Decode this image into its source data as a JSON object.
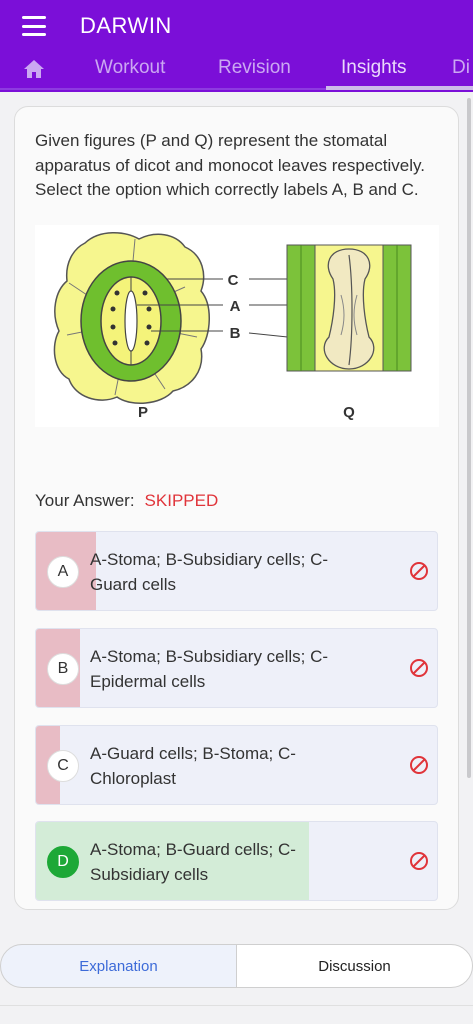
{
  "app": {
    "title": "DARWIN"
  },
  "tabs": [
    {
      "label": "Workout"
    },
    {
      "label": "Revision"
    },
    {
      "label": "Insights"
    },
    {
      "label": "Di"
    }
  ],
  "question": {
    "text": "Given figures (P and Q) represent the stomatal apparatus of dicot and monocot leaves respectively. Select the option which correctly labels A, B and C.",
    "figure_labels": {
      "c": "C",
      "a": "A",
      "b": "B",
      "p": "P",
      "q": "Q"
    }
  },
  "answer": {
    "label": "Your Answer:",
    "status": "SKIPPED"
  },
  "options": [
    {
      "letter": "A",
      "text": "A-Stoma; B-Subsidiary cells; C-Guard cells",
      "fill_fraction": 0.15,
      "fill_color": "#e8bcc5",
      "correct": false
    },
    {
      "letter": "B",
      "text": "A-Stoma; B-Subsidiary cells; C-Epidermal cells",
      "fill_fraction": 0.11,
      "fill_color": "#e8bcc5",
      "correct": false
    },
    {
      "letter": "C",
      "text": "A-Guard cells; B-Stoma; C-Chloroplast",
      "fill_fraction": 0.06,
      "fill_color": "#e8bcc5",
      "correct": false
    },
    {
      "letter": "D",
      "text": "A-Stoma; B-Guard cells; C-Subsidiary cells",
      "fill_fraction": 0.68,
      "fill_color": "#d3ecd7",
      "correct": true
    }
  ],
  "bottom_tabs": {
    "explanation": "Explanation",
    "discussion": "Discussion"
  },
  "icons": {
    "menu": "menu-icon",
    "home": "home-icon",
    "skipped": "no-entry-icon"
  },
  "colors": {
    "brand": "#7b0fd8",
    "skipped": "#e0343a",
    "correct": "#1da837"
  }
}
